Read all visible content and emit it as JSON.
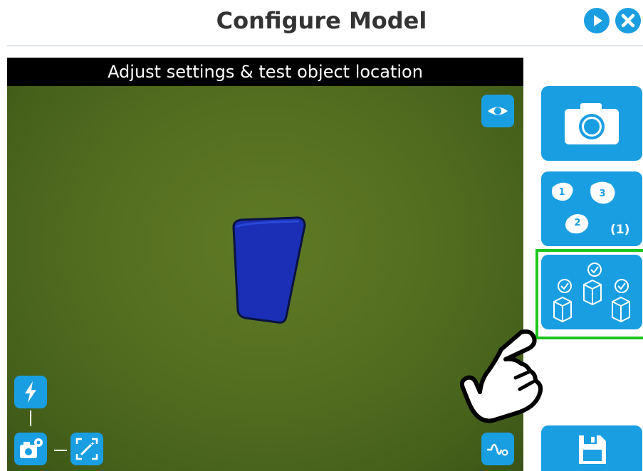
{
  "header": {
    "title": "Configure Model"
  },
  "viewer": {
    "caption": "Adjust settings & test object location"
  },
  "sidebar": {
    "model_count": "(1)",
    "parts": [
      "1",
      "2",
      "3"
    ]
  },
  "colors": {
    "accent": "#1a9ee2",
    "highlight": "#1ec51e",
    "header_text": "#333333",
    "object": "#1a2fb5",
    "background": "#546e20"
  }
}
